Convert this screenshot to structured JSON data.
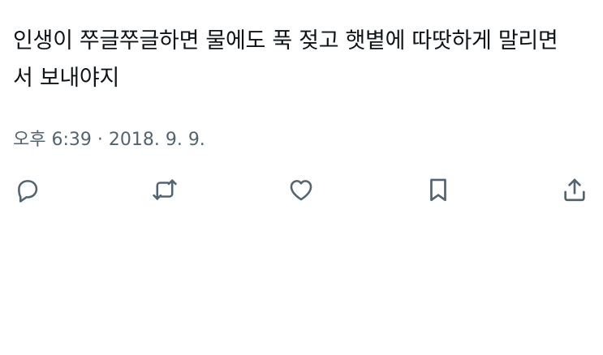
{
  "tweet": {
    "text_line_1": "인생이 쭈글쭈글하면 물에도 푹 젖고 햇볕에 따땃하게 말리면",
    "text_line_2": "서 보내야지",
    "timestamp": "오후 6:39 · 2018. 9. 9."
  },
  "actions": {
    "reply_icon": "reply-icon",
    "retweet_icon": "retweet-icon",
    "like_icon": "heart-icon",
    "bookmark_icon": "bookmark-icon",
    "share_icon": "share-icon",
    "icon_color": "#536471"
  },
  "colors": {
    "text": "#0f1419",
    "secondary": "#536471",
    "background": "#ffffff"
  }
}
